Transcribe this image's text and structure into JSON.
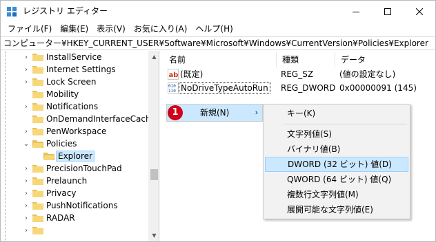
{
  "window": {
    "title": "レジストリ エディター"
  },
  "menubar": {
    "items": [
      "ファイル(F)",
      "編集(E)",
      "表示(V)",
      "お気に入り(A)",
      "ヘルプ(H)"
    ]
  },
  "address": {
    "path": "コンピューター¥HKEY_CURRENT_USER¥Software¥Microsoft¥Windows¥CurrentVersion¥Policies¥Explorer"
  },
  "tree": {
    "items": [
      {
        "label": "InstallService",
        "state": "collapsed"
      },
      {
        "label": "Internet Settings",
        "state": "collapsed"
      },
      {
        "label": "Lock Screen",
        "state": "collapsed"
      },
      {
        "label": "Mobility",
        "state": "none"
      },
      {
        "label": "Notifications",
        "state": "collapsed"
      },
      {
        "label": "OnDemandInterfaceCache",
        "state": "none"
      },
      {
        "label": "PenWorkspace",
        "state": "collapsed"
      },
      {
        "label": "Policies",
        "state": "expanded"
      },
      {
        "label": "Explorer",
        "state": "selected"
      },
      {
        "label": "PrecisionTouchPad",
        "state": "collapsed"
      },
      {
        "label": "Prelaunch",
        "state": "collapsed"
      },
      {
        "label": "Privacy",
        "state": "collapsed"
      },
      {
        "label": "PushNotifications",
        "state": "collapsed"
      },
      {
        "label": "RADAR",
        "state": "collapsed"
      }
    ]
  },
  "values": {
    "columns": [
      "名前",
      "種類",
      "データ"
    ],
    "rows": [
      {
        "icon": "string-value-icon",
        "name": "(既定)",
        "type": "REG_SZ",
        "data": "(値の設定なし)"
      },
      {
        "icon": "binary-value-icon",
        "name": "NoDriveTypeAutoRun",
        "type": "REG_DWORD",
        "data": "0x00000091 (145)"
      }
    ]
  },
  "context_menu": {
    "badge": "1",
    "item": "新規(N)",
    "arrow": "›"
  },
  "submenu": {
    "items": [
      "キー(K)",
      "文字列値(S)",
      "バイナリ値(B)",
      "DWORD (32 ビット) 値(D)",
      "QWORD (64 ビット) 値(Q)",
      "複数行文字列値(M)",
      "展開可能な文字列値(E)"
    ],
    "highlighted": "DWORD (32 ビット) 値(D)"
  },
  "colors": {
    "selection": "#cce8ff",
    "folder": "#e8c15a",
    "badge": "#d0021b"
  }
}
